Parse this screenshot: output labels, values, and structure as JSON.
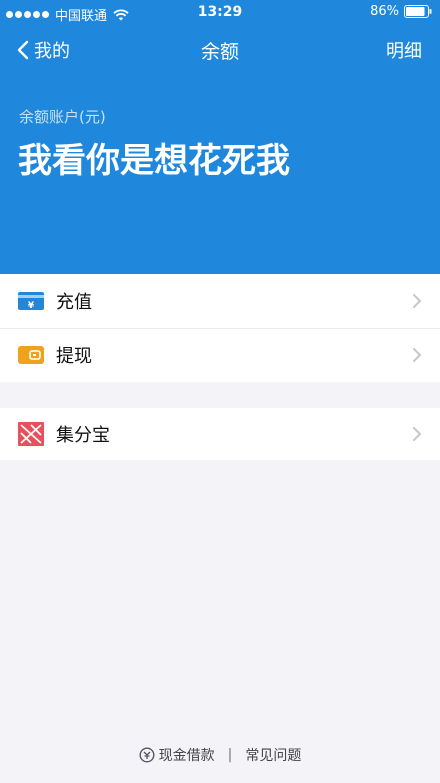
{
  "status_bar": {
    "carrier": "中国联通",
    "time": "13:29",
    "battery": "86%"
  },
  "nav": {
    "back_label": "我的",
    "title": "余额",
    "right_label": "明细"
  },
  "balance": {
    "label": "余额账户(元)",
    "value": "我看你是想花死我"
  },
  "list": {
    "recharge": "充值",
    "withdraw": "提现",
    "jifenbao": "集分宝"
  },
  "footer": {
    "loan": "现金借款",
    "separator": "|",
    "faq": "常见问题"
  },
  "colors": {
    "header_blue": "#1f88dc",
    "recharge_icon": "#1f88dc",
    "withdraw_icon": "#f0a21f",
    "jifenbao_icon": "#e8505b"
  }
}
